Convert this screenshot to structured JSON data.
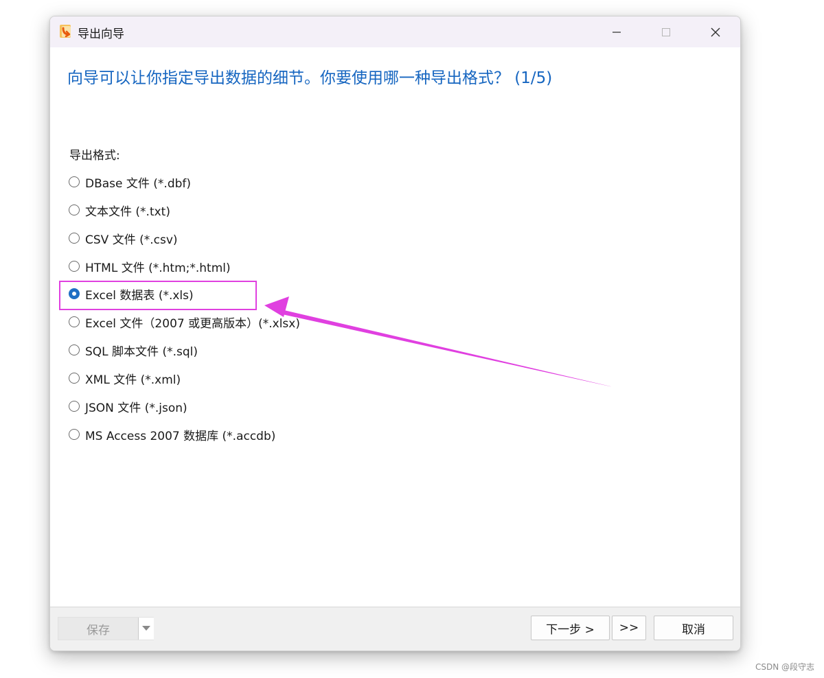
{
  "window": {
    "title": "导出向导",
    "app_icon": "navicat-export-icon",
    "controls": {
      "minimize_icon": "minimize-icon",
      "maximize_icon": "maximize-icon",
      "close_icon": "close-icon"
    }
  },
  "main": {
    "heading": "向导可以让你指定导出数据的细节。你要使用哪一种导出格式？ (1/5)",
    "group_label": "导出格式:",
    "formats": [
      {
        "label": "DBase 文件 (*.dbf)",
        "checked": false
      },
      {
        "label": "文本文件 (*.txt)",
        "checked": false
      },
      {
        "label": "CSV 文件 (*.csv)",
        "checked": false
      },
      {
        "label": "HTML 文件 (*.htm;*.html)",
        "checked": false
      },
      {
        "label": "Excel 数据表 (*.xls)",
        "checked": true
      },
      {
        "label": "Excel 文件（2007 或更高版本）(*.xlsx)",
        "checked": false
      },
      {
        "label": "SQL 脚本文件 (*.sql)",
        "checked": false
      },
      {
        "label": "XML 文件 (*.xml)",
        "checked": false
      },
      {
        "label": "JSON 文件 (*.json)",
        "checked": false
      },
      {
        "label": "MS Access 2007 数据库 (*.accdb)",
        "checked": false
      }
    ],
    "selected_format": "Excel 数据表 (*.xls)"
  },
  "annotation": {
    "highlight_color": "#e040e0",
    "arrow_color": "#e040e0"
  },
  "footer": {
    "save_label": "保存",
    "save_enabled": false,
    "next_label": "下一步 >",
    "last_label": ">>",
    "cancel_label": "取消"
  },
  "watermark": "CSDN @段守志",
  "colors": {
    "heading": "#1565c0",
    "radio_checked": "#1f6fc4",
    "titlebar_bg": "#f4f0f8"
  }
}
